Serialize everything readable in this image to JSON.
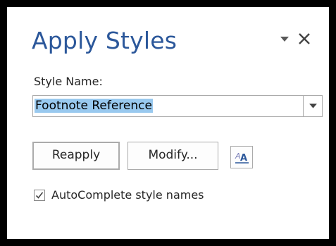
{
  "pane": {
    "title": "Apply Styles",
    "options_icon": "chevron-down-icon",
    "close_icon": "close-icon"
  },
  "style_name": {
    "label": "Style Name:",
    "value": "Footnote Reference",
    "dropdown_icon": "dropdown-arrow-icon"
  },
  "buttons": {
    "reapply_label": "Reapply",
    "modify_label": "Modify...",
    "styles_icon": "styles-pane-icon",
    "styles_icon_text": "A"
  },
  "autocomplete": {
    "label": "AutoComplete style names",
    "checked": true
  },
  "colors": {
    "title": "#2b579a",
    "selection": "#99c9ef",
    "border": "#ababab",
    "frame": "#000000"
  }
}
